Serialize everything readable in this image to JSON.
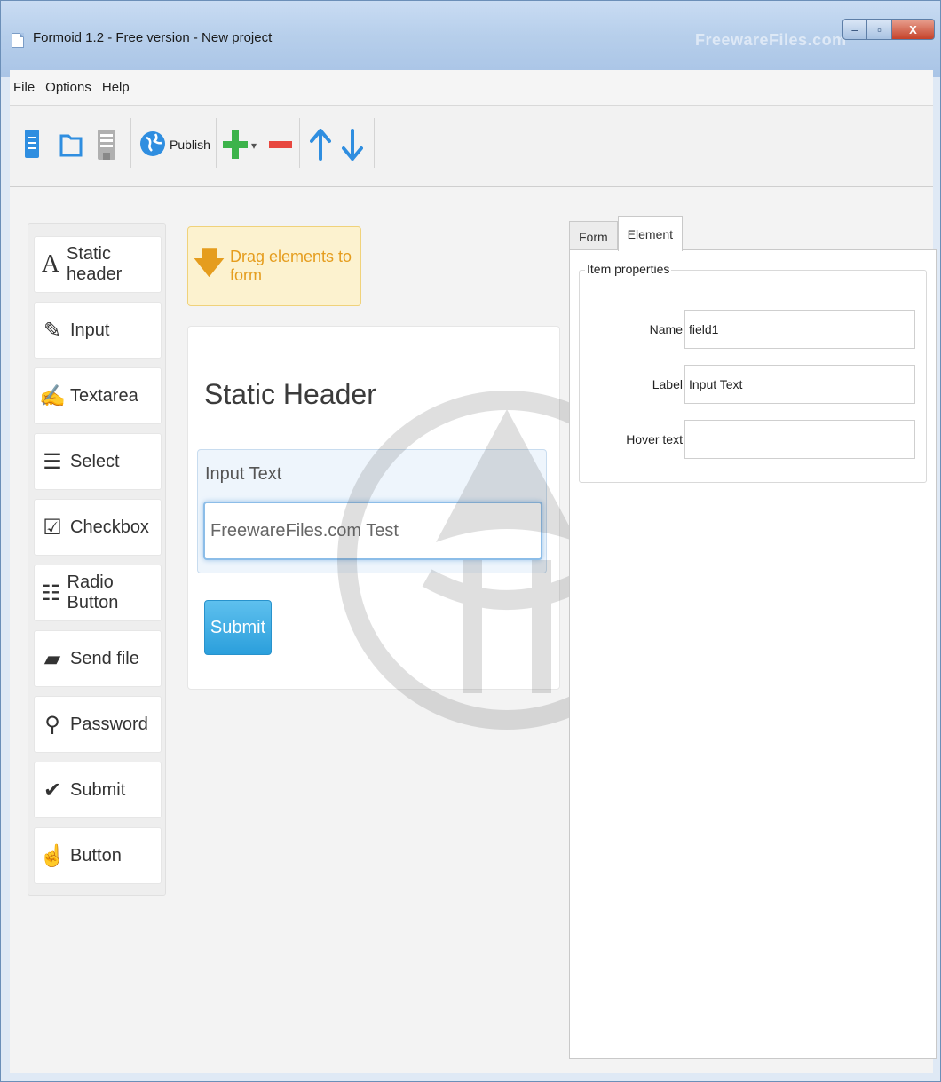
{
  "window": {
    "title": "Formoid 1.2 - Free version - New project",
    "brand_watermark": "FreewareFiles.com",
    "controls": {
      "minimize": "–",
      "maximize": "▫",
      "close": "X"
    }
  },
  "menu": [
    "File",
    "Options",
    "Help"
  ],
  "toolbar": {
    "publish_label": "Publish",
    "add_dropdown_symbol": "▾"
  },
  "palette": [
    {
      "label": "Static header",
      "icon": "letter-a-icon",
      "glyph": "A"
    },
    {
      "label": "Input",
      "icon": "pencil-icon",
      "glyph": "✎"
    },
    {
      "label": "Textarea",
      "icon": "edit-box-icon",
      "glyph": "✍"
    },
    {
      "label": "Select",
      "icon": "list-lines-icon",
      "glyph": "☰"
    },
    {
      "label": "Checkbox",
      "icon": "checkbox-icon",
      "glyph": "☑"
    },
    {
      "label": "Radio Button",
      "icon": "radio-list-icon",
      "glyph": "☷"
    },
    {
      "label": "Send file",
      "icon": "folder-open-icon",
      "glyph": "▰"
    },
    {
      "label": "Password",
      "icon": "key-icon",
      "glyph": "⚲"
    },
    {
      "label": "Submit",
      "icon": "checkmark-icon",
      "glyph": "✔"
    },
    {
      "label": "Button",
      "icon": "hand-pointer-icon",
      "glyph": "☝"
    }
  ],
  "drag_hint": {
    "text": "Drag elements to form",
    "glyph": "🡇"
  },
  "form": {
    "header": "Static Header",
    "input_label": "Input Text",
    "input_value": "FreewareFiles.com Test",
    "submit_label": "Submit"
  },
  "properties": {
    "tabs": [
      "Form",
      "Element"
    ],
    "active_tab": "Element",
    "group_title": "Item properties",
    "fields": [
      {
        "label": "Name",
        "value": "field1"
      },
      {
        "label": "Label",
        "value": "Input Text"
      },
      {
        "label": "Hover text",
        "value": ""
      }
    ]
  },
  "colors": {
    "accent_orange": "#e59d1e",
    "submit_blue": "#2b9fdc",
    "toolbar_green": "#3cb34a",
    "toolbar_red": "#e8473f",
    "toolbar_blue": "#2f8ee0"
  }
}
